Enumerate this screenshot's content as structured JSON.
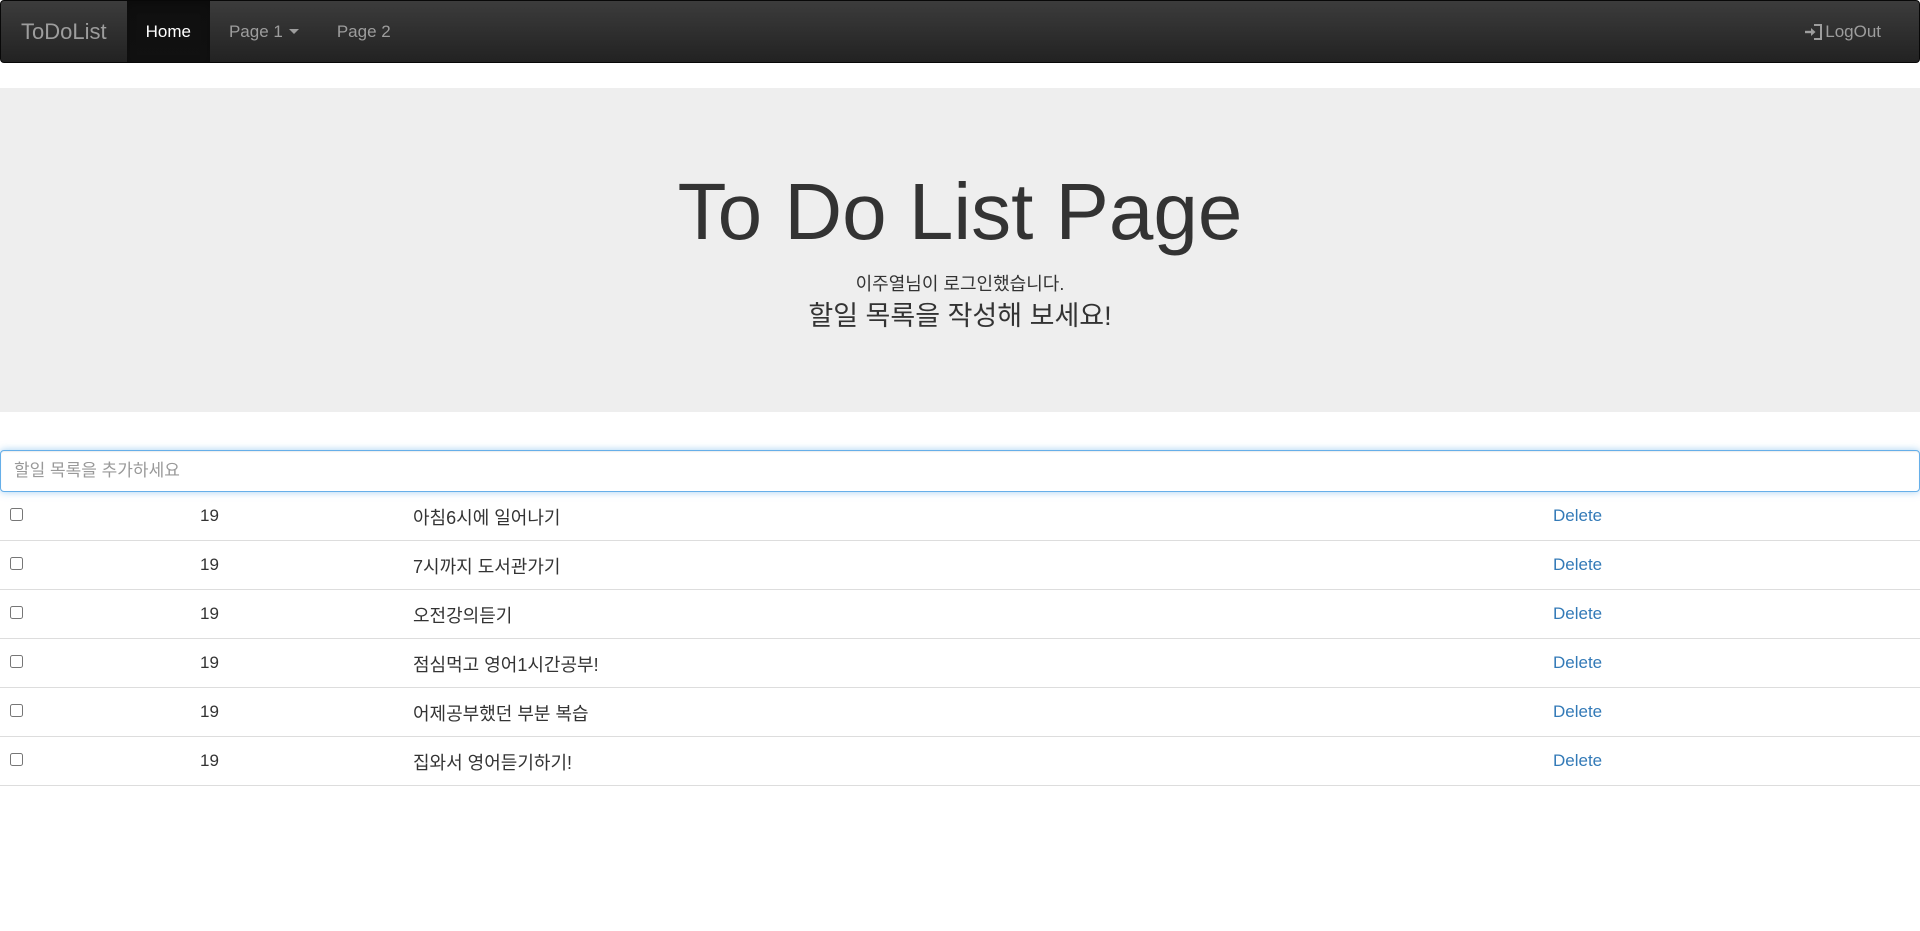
{
  "navbar": {
    "brand": "ToDoList",
    "items": [
      {
        "label": "Home",
        "active": true
      },
      {
        "label": "Page 1",
        "dropdown": true
      },
      {
        "label": "Page 2"
      }
    ],
    "logout_label": "LogOut",
    "logout_icon": "log-in-icon"
  },
  "jumbotron": {
    "title": "To Do List Page",
    "user_message": "이주열님이 로그인했습니다.",
    "subtitle": "할일 목록을 작성해 보세요!"
  },
  "add_input": {
    "placeholder": "할일 목록을 추가하세요",
    "value": ""
  },
  "todos": [
    {
      "checked": false,
      "num": "19",
      "text": "아침6시에 일어나기",
      "delete_label": "Delete"
    },
    {
      "checked": false,
      "num": "19",
      "text": "7시까지 도서관가기",
      "delete_label": "Delete"
    },
    {
      "checked": false,
      "num": "19",
      "text": "오전강의듣기",
      "delete_label": "Delete"
    },
    {
      "checked": false,
      "num": "19",
      "text": "점심먹고 영어1시간공부!",
      "delete_label": "Delete"
    },
    {
      "checked": false,
      "num": "19",
      "text": "어제공부했던 부분 복습",
      "delete_label": "Delete"
    },
    {
      "checked": false,
      "num": "19",
      "text": "집와서 영어듣기하기!",
      "delete_label": "Delete"
    }
  ],
  "colors": {
    "navbar_bg": "#222222",
    "jumbotron_bg": "#eeeeee",
    "link": "#337ab7",
    "input_focus": "#66afe9"
  }
}
